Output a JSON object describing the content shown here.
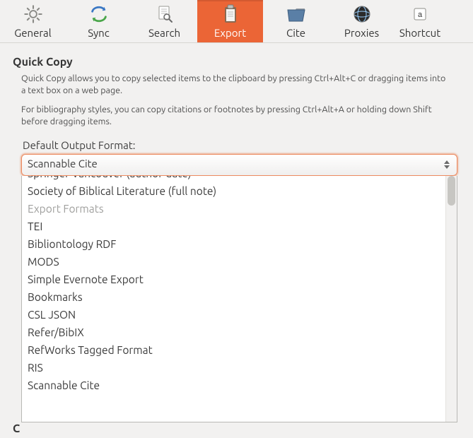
{
  "toolbar": {
    "tabs": [
      {
        "id": "general",
        "label": "General"
      },
      {
        "id": "sync",
        "label": "Sync"
      },
      {
        "id": "search",
        "label": "Search"
      },
      {
        "id": "export",
        "label": "Export",
        "selected": true
      },
      {
        "id": "cite",
        "label": "Cite"
      },
      {
        "id": "proxies",
        "label": "Proxies"
      },
      {
        "id": "shortcut",
        "label": "Shortcut"
      }
    ]
  },
  "section": {
    "title": "Quick Copy",
    "help1": "Quick Copy allows you to copy selected items to the clipboard by pressing Ctrl+Alt+C or dragging items into a text box on a web page.",
    "help2": "For bibliography styles, you can copy citations or footnotes by pressing Ctrl+Alt+A or holding down Shift before dragging items.",
    "field_label": "Default Output Format:",
    "selected_value": "Scannable Cite",
    "truncated_heading_below": "C"
  },
  "dropdown": {
    "visible_options": [
      {
        "label": "Springer Vancouver (author-date)",
        "kind": "item",
        "cut": true
      },
      {
        "label": "Society of Biblical Literature (full note)",
        "kind": "item"
      },
      {
        "label": "Export Formats",
        "kind": "group"
      },
      {
        "label": "TEI",
        "kind": "item"
      },
      {
        "label": "Bibliontology RDF",
        "kind": "item"
      },
      {
        "label": "MODS",
        "kind": "item"
      },
      {
        "label": "Simple Evernote Export",
        "kind": "item"
      },
      {
        "label": "Bookmarks",
        "kind": "item"
      },
      {
        "label": "CSL JSON",
        "kind": "item"
      },
      {
        "label": "Refer/BibIX",
        "kind": "item"
      },
      {
        "label": "RefWorks Tagged Format",
        "kind": "item"
      },
      {
        "label": "RIS",
        "kind": "item"
      },
      {
        "label": "Scannable Cite",
        "kind": "item"
      }
    ]
  }
}
